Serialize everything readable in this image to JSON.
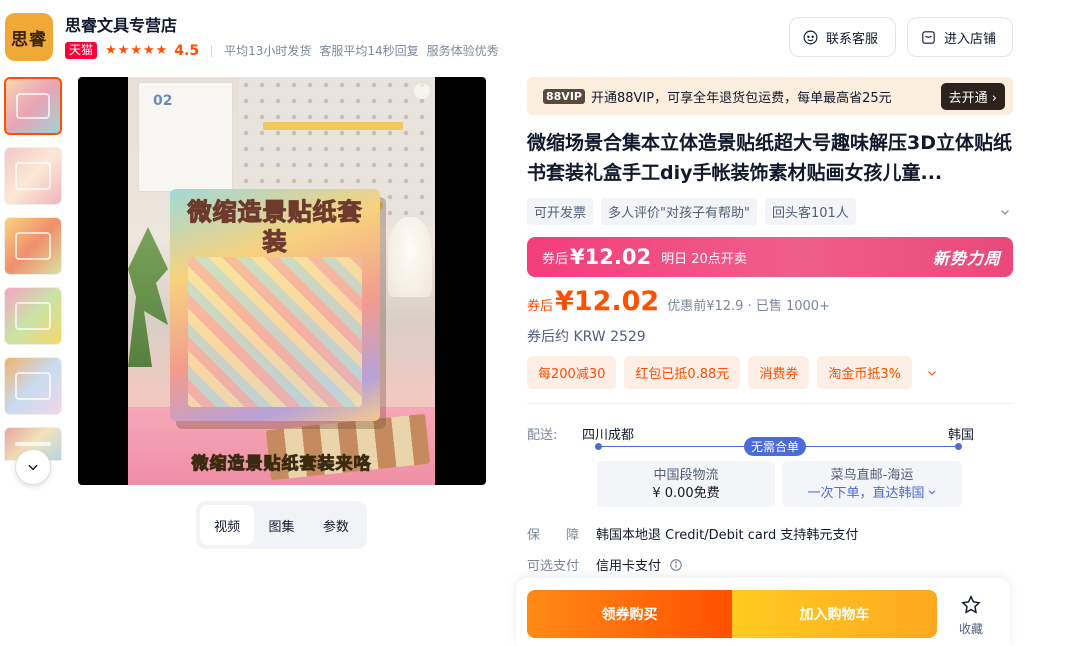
{
  "shop": {
    "logo_text": "思睿",
    "name": "思睿文具专营店",
    "platform_tag": "天猫",
    "stars": "★★★★★",
    "rating": "4.5",
    "services": [
      "平均13小时发货",
      "客服平均14秒回复",
      "服务体验优秀"
    ]
  },
  "header": {
    "contact_label": "联系客服",
    "store_label": "进入店铺"
  },
  "media": {
    "calendar_number": "02",
    "book_title": "微缩造景贴纸套装",
    "caption": "微缩造景贴纸套装来咯"
  },
  "media_tabs": [
    {
      "label": "视频",
      "active": true
    },
    {
      "label": "图集",
      "active": false
    },
    {
      "label": "参数",
      "active": false
    }
  ],
  "vip": {
    "tag": "88VIP",
    "text": "开通88VIP，可享全年退货包运费，每单最高省25元",
    "button": "去开通 ›"
  },
  "product": {
    "title": "微缩场景合集本立体造景贴纸超大号趣味解压3D立体贴纸书套装礼盒手工diy手帐装饰素材贴画女孩儿童...",
    "tags": [
      "可开发票",
      "多人评价\"对孩子有帮助\"",
      "回头客101人"
    ]
  },
  "promo": {
    "label": "券后",
    "price": "¥12.02",
    "sale_time": "明日 20点开卖",
    "badge": "新势力周"
  },
  "price": {
    "label": "券后",
    "value": "¥12.02",
    "original": "优惠前¥12.9 · 已售 1000+",
    "krw": "券后约 KRW 2529"
  },
  "coupons": [
    "每200减30",
    "红包已抵0.88元",
    "消费券",
    "淘金币抵3%"
  ],
  "shipping": {
    "label": "配送:",
    "from": "四川成都",
    "to": "韩国",
    "badge": "无需合单",
    "option1_title": "中国段物流",
    "option1_value": "¥ 0.00免费",
    "option2_title": "菜鸟直邮-海运",
    "option2_value": "一次下单，直达韩国"
  },
  "guarantee": {
    "label": "保　　障",
    "value": "韩国本地退 Credit/Debit card 支持韩元支付"
  },
  "payment": {
    "label": "可选支付",
    "value": "信用卡支付"
  },
  "actions": {
    "buy_now": "领券购买",
    "add_cart": "加入购物车",
    "favorite": "收藏"
  },
  "colors": {
    "accent": "#ff5000",
    "promo_pink": "#f23e7b",
    "link_blue": "#4a6bd8"
  }
}
